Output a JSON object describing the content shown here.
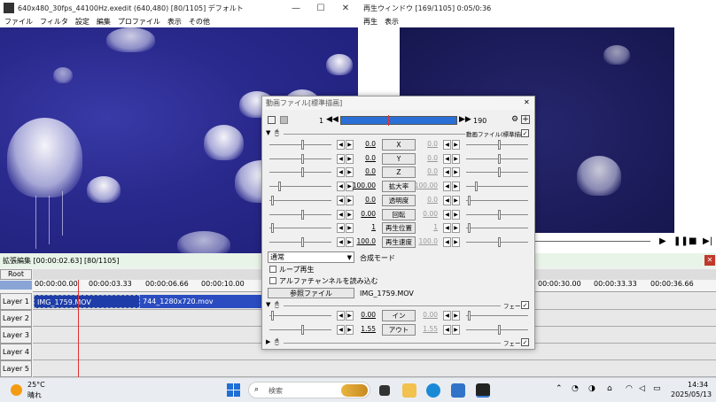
{
  "main_window": {
    "title": "640x480_30fps_44100Hz.exedit (640,480)  [80/1105]  デフォルト",
    "menu": [
      "ファイル",
      "フィルタ",
      "設定",
      "編集",
      "プロファイル",
      "表示",
      "その他"
    ]
  },
  "preview_window": {
    "title": "再生ウィンドウ [169/1105]  0:05/0:36",
    "menu": [
      "再生",
      "表示"
    ]
  },
  "timeline": {
    "title": "拡張編集 [00:00:02.63] [80/1105]",
    "root_label": "Root",
    "ruler_ticks": [
      "00:00:00.00",
      "00:00:03.33",
      "00:00:06.66",
      "00:00:10.00",
      "00:00:30.00",
      "00:00:33.33",
      "00:00:36.66"
    ],
    "layers": [
      "Layer 1",
      "Layer 2",
      "Layer 3",
      "Layer 4",
      "Layer 5"
    ],
    "clips": [
      {
        "label": "IMG_1759.MOV"
      },
      {
        "label": "744_1280x720.mov"
      }
    ]
  },
  "dialog": {
    "title": "動画ファイル[標準描画]",
    "frame_start": "1",
    "frame_end": "190",
    "section_label": "動画ファイル(標準描画)",
    "params": [
      {
        "name": "X",
        "left": "0.0",
        "right": "0.0"
      },
      {
        "name": "Y",
        "left": "0.0",
        "right": "0.0"
      },
      {
        "name": "Z",
        "left": "0.0",
        "right": "0.0"
      },
      {
        "name": "拡大率",
        "left": "100.00",
        "right": "100.00"
      },
      {
        "name": "透明度",
        "left": "0.0",
        "right": "0.0"
      },
      {
        "name": "回転",
        "left": "0.00",
        "right": "0.00"
      },
      {
        "name": "再生位置",
        "left": "1",
        "right": "1"
      },
      {
        "name": "再生速度",
        "left": "100.0",
        "right": "100.0"
      }
    ],
    "blend_mode": "通常",
    "blend_label": "合成モード",
    "loop_label": "ループ再生",
    "alpha_label": "アルファチャンネルを読み込む",
    "ref_button": "参照ファイル",
    "ref_file": "IMG_1759.MOV",
    "fade_label": "フェード",
    "fade_params": [
      {
        "name": "イン",
        "left": "0.00",
        "right": "0.00"
      },
      {
        "name": "アウト",
        "left": "1.55",
        "right": "1.55"
      }
    ],
    "fade2_label": "フェード"
  },
  "taskbar": {
    "weather_temp": "25°C",
    "weather_desc": "晴れ",
    "search_placeholder": "検索",
    "time": "14:34",
    "date": "2025/05/13"
  }
}
